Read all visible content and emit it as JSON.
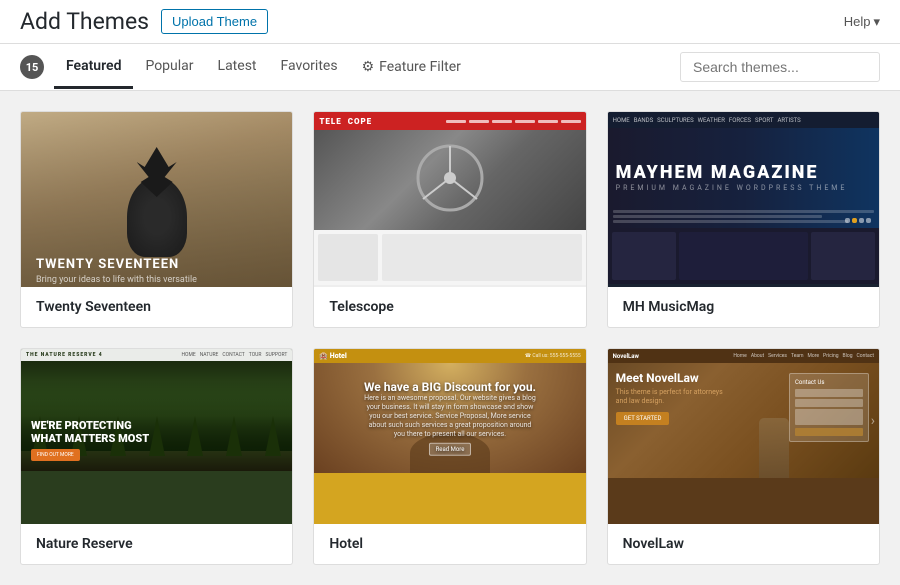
{
  "header": {
    "title": "Add Themes",
    "upload_button": "Upload Theme",
    "help_label": "Help"
  },
  "nav": {
    "count": "15",
    "tabs": [
      {
        "id": "featured",
        "label": "Featured",
        "active": true
      },
      {
        "id": "popular",
        "label": "Popular",
        "active": false
      },
      {
        "id": "latest",
        "label": "Latest",
        "active": false
      },
      {
        "id": "favorites",
        "label": "Favorites",
        "active": false
      }
    ],
    "feature_filter": "Feature Filter",
    "search_placeholder": "Search themes..."
  },
  "themes": [
    {
      "id": "twenty-seventeen",
      "name": "Twenty Seventeen",
      "preview_type": "twentyseventeen"
    },
    {
      "id": "telescope",
      "name": "Telescope",
      "preview_type": "telescope"
    },
    {
      "id": "mh-musicmag",
      "name": "MH MusicMag",
      "preview_type": "musicmag"
    },
    {
      "id": "nature-reserve",
      "name": "Nature Reserve",
      "preview_type": "nature"
    },
    {
      "id": "hotel",
      "name": "Hotel",
      "preview_type": "hotel"
    },
    {
      "id": "novellaw",
      "name": "NovelLaw",
      "preview_type": "novellaw"
    }
  ]
}
